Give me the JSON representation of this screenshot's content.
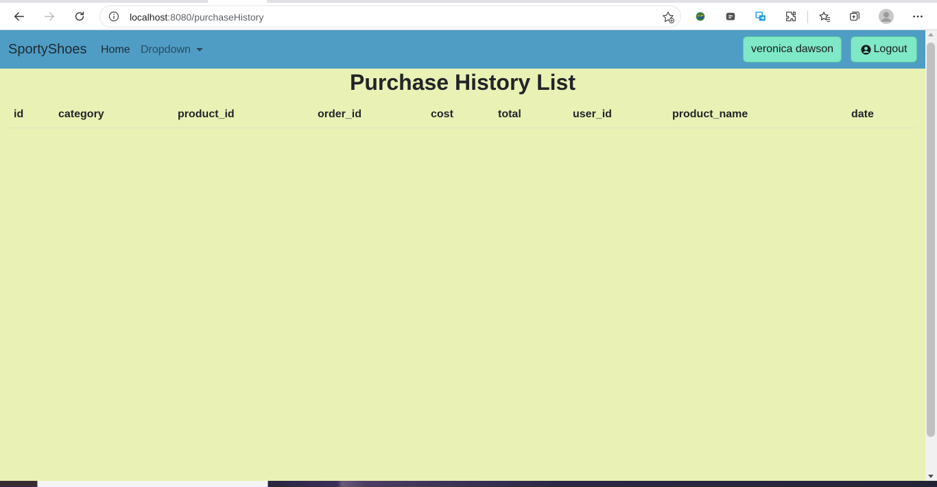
{
  "browser": {
    "url_host": "localhost",
    "url_rest": ":8080/purchaseHistory"
  },
  "navbar": {
    "brand": "SportyShoes",
    "home": "Home",
    "dropdown": "Dropdown",
    "user_button": "veronica dawson",
    "logout_button": "Logout"
  },
  "page": {
    "title": "Purchase History List"
  },
  "table": {
    "columns": [
      "id",
      "category",
      "product_id",
      "order_id",
      "cost",
      "total",
      "user_id",
      "product_name",
      "date"
    ],
    "rows": []
  },
  "colors": {
    "page_background": "#eaf1b5",
    "navbar_background": "#4f9dc5",
    "button_background": "#7fe8c6"
  }
}
